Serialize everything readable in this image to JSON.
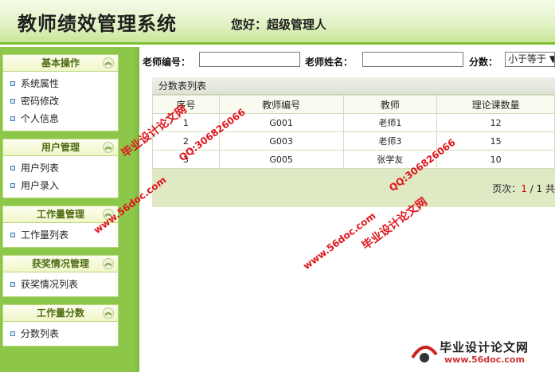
{
  "header": {
    "title": "教师绩效管理系统",
    "greeting": "您好：超级管理人"
  },
  "sidebar": {
    "groups": [
      {
        "title": "基本操作",
        "items": [
          "系统属性",
          "密码修改",
          "个人信息"
        ]
      },
      {
        "title": "用户管理",
        "items": [
          "用户列表",
          "用户录入"
        ]
      },
      {
        "title": "工作量管理",
        "items": [
          "工作量列表"
        ]
      },
      {
        "title": "获奖情况管理",
        "items": [
          "获奖情况列表"
        ]
      },
      {
        "title": "工作量分数",
        "items": [
          "分数列表"
        ]
      }
    ]
  },
  "search": {
    "teacher_id_label": "老师编号：",
    "teacher_id_value": "",
    "teacher_name_label": "老师姓名：",
    "teacher_name_value": "",
    "score_label": "分数：",
    "score_operator": "小于等于 ▼"
  },
  "table": {
    "caption": "分数表列表",
    "columns": [
      "序号",
      "教师编号",
      "教师",
      "理论课数量"
    ],
    "rows": [
      [
        "1",
        "G001",
        "老师1",
        "12"
      ],
      [
        "2",
        "G003",
        "老师3",
        "15"
      ],
      [
        "3",
        "G005",
        "张学友",
        "10"
      ]
    ]
  },
  "pager": {
    "label": "页次：",
    "current": "1",
    "sep": " / 1 共"
  },
  "watermarks": {
    "w1": "毕业设计论文网",
    "w2": "QQ:306826066",
    "w3": "www.56doc.com",
    "corner_title": "毕业设计论文网",
    "corner_url": "www.56doc.com"
  }
}
